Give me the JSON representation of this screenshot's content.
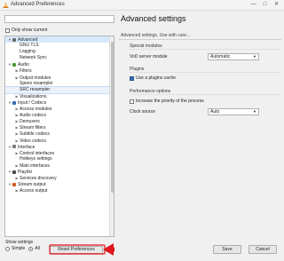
{
  "window": {
    "title": "Advanced Preferences",
    "min": "—",
    "max": "□",
    "close": "✕"
  },
  "search": {
    "value": "",
    "placeholder": ""
  },
  "only_show_current": "Only show current",
  "tree": [
    {
      "label": "Advanced",
      "arrow": "▼",
      "icon": "wrench-icon",
      "color": "#6b6b6b",
      "state": "selected",
      "indent": 0
    },
    {
      "label": "GNU TLS",
      "arrow": "",
      "icon": "",
      "color": "",
      "state": "",
      "indent": 1
    },
    {
      "label": "Logging",
      "arrow": "",
      "icon": "",
      "color": "",
      "state": "",
      "indent": 1
    },
    {
      "label": "Network Sync",
      "arrow": "",
      "icon": "",
      "color": "",
      "state": "",
      "indent": 1
    },
    {
      "label": "Audio",
      "arrow": "▼",
      "icon": "audio-note-icon",
      "color": "#4d9a2e",
      "state": "",
      "indent": 0
    },
    {
      "label": "Filters",
      "arrow": "▶",
      "icon": "",
      "color": "",
      "state": "",
      "indent": 1
    },
    {
      "label": "Output modules",
      "arrow": "▶",
      "icon": "",
      "color": "",
      "state": "",
      "indent": 1
    },
    {
      "label": "Speex resampler",
      "arrow": "",
      "icon": "",
      "color": "",
      "state": "",
      "indent": 1
    },
    {
      "label": "SRC resampler",
      "arrow": "",
      "icon": "",
      "color": "",
      "state": "highlight",
      "indent": 1
    },
    {
      "label": "Visualizations",
      "arrow": "▶",
      "icon": "",
      "color": "",
      "state": "",
      "indent": 1
    },
    {
      "label": "Input / Codecs",
      "arrow": "▼",
      "icon": "input-codecs-icon",
      "color": "#3568b5",
      "state": "",
      "indent": 0
    },
    {
      "label": "Access modules",
      "arrow": "▶",
      "icon": "",
      "color": "",
      "state": "",
      "indent": 1
    },
    {
      "label": "Audio codecs",
      "arrow": "▶",
      "icon": "",
      "color": "",
      "state": "",
      "indent": 1
    },
    {
      "label": "Demuxers",
      "arrow": "▶",
      "icon": "",
      "color": "",
      "state": "",
      "indent": 1
    },
    {
      "label": "Stream filters",
      "arrow": "▶",
      "icon": "",
      "color": "",
      "state": "",
      "indent": 1
    },
    {
      "label": "Subtitle codecs",
      "arrow": "▶",
      "icon": "",
      "color": "",
      "state": "",
      "indent": 1
    },
    {
      "label": "Video codecs",
      "arrow": "▶",
      "icon": "",
      "color": "",
      "state": "",
      "indent": 1
    },
    {
      "label": "Interface",
      "arrow": "▼",
      "icon": "interface-icon",
      "color": "#7a7a7a",
      "state": "",
      "indent": 0
    },
    {
      "label": "Control interfaces",
      "arrow": "▶",
      "icon": "",
      "color": "",
      "state": "",
      "indent": 1
    },
    {
      "label": "Hotkeys settings",
      "arrow": "",
      "icon": "",
      "color": "",
      "state": "",
      "indent": 1
    },
    {
      "label": "Main interfaces",
      "arrow": "▶",
      "icon": "",
      "color": "",
      "state": "",
      "indent": 1
    },
    {
      "label": "Playlist",
      "arrow": "▼",
      "icon": "playlist-icon",
      "color": "#4a4a4a",
      "state": "",
      "indent": 0
    },
    {
      "label": "Services discovery",
      "arrow": "▶",
      "icon": "",
      "color": "",
      "state": "",
      "indent": 1
    },
    {
      "label": "Stream output",
      "arrow": "▼",
      "icon": "stream-output-icon",
      "color": "#d25a1c",
      "state": "",
      "indent": 0
    },
    {
      "label": "Access output",
      "arrow": "▶",
      "icon": "",
      "color": "",
      "state": "",
      "indent": 1
    }
  ],
  "footer": {
    "show_settings": "Show settings",
    "simple": "Simple",
    "all": "All",
    "reset": "Reset Preferences",
    "save": "Save",
    "cancel": "Cancel"
  },
  "panel": {
    "title": "Advanced settings",
    "subtitle": "Advanced settings. Use with care...",
    "special_modules": "Special modules",
    "vod_label": "VoD server module",
    "vod_value": "Automatic",
    "plugins": "Plugins",
    "use_plugins_cache": "Use a plugins cache",
    "performance": "Performance options",
    "increase_priority": "Increase the priority of the process",
    "clock_label": "Clock source",
    "clock_value": "Auto"
  },
  "colors": {
    "selection": "#d6e8fb",
    "annotation_arrow": "#e0171c"
  }
}
